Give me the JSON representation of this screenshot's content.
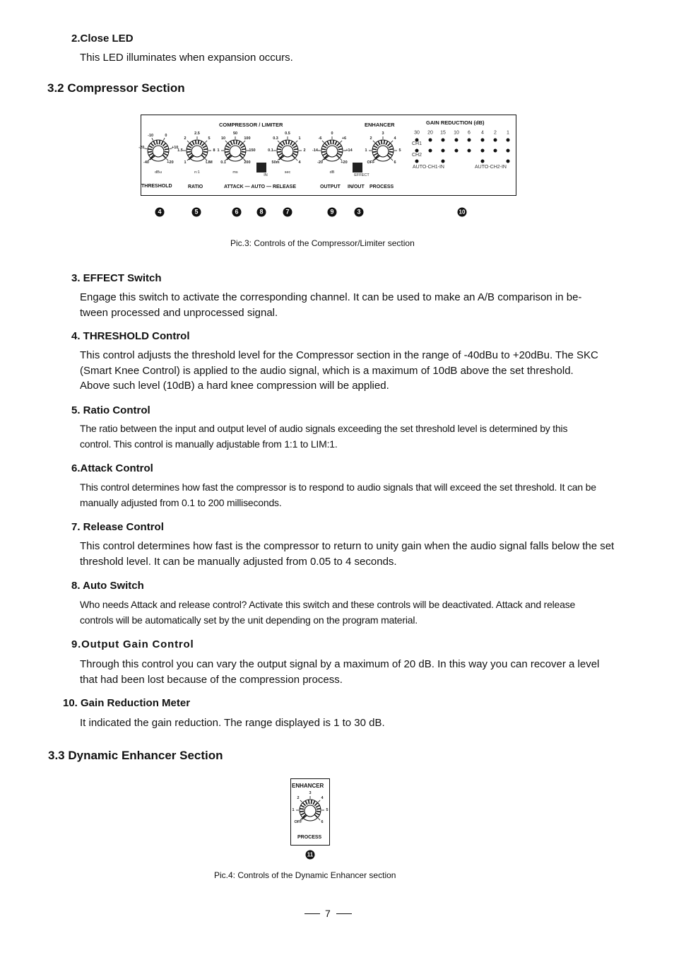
{
  "sections": {
    "close_led": {
      "heading": "2.Close LED",
      "text": "This LED illuminates when expansion occurs."
    },
    "compressor": {
      "heading": "3.2 Compressor Section"
    },
    "enhancer_section": {
      "heading": "3.3 Dynamic Enhancer Section"
    }
  },
  "figure3": {
    "caption": "Pic.3: Controls of the Compressor/Limiter section",
    "panel": {
      "compressor_title": "COMPRESSOR / LIMITER",
      "enhancer_title": "ENHANCER",
      "gain_title": "GAIN REDUCTION (dB)",
      "knobs": [
        {
          "id": "threshold",
          "scale": [
            "-40",
            "-20",
            "-10",
            "0",
            "+10",
            "+20"
          ],
          "unit": "dBu"
        },
        {
          "id": "ratio",
          "scale": [
            "1",
            "1.5",
            "2",
            "2.5",
            "5",
            "8",
            "LIM"
          ],
          "unit": "n:1"
        },
        {
          "id": "attack",
          "scale": [
            "0.1",
            "1",
            "10",
            "50",
            "100",
            "150",
            "200"
          ],
          "unit": "ms"
        },
        {
          "id": "release",
          "scale": [
            "50m",
            "0.1",
            "0.3",
            "0.5",
            "1",
            "2",
            "4"
          ],
          "unit": "sec"
        },
        {
          "id": "output",
          "scale": [
            "-20",
            "-14",
            "-6",
            "0",
            "+6",
            "+14",
            "+20"
          ],
          "unit": "dB"
        },
        {
          "id": "process",
          "scale": [
            "OFF",
            "1",
            "2",
            "3",
            "4",
            "5",
            "6"
          ],
          "unit": ""
        }
      ],
      "auto_switch_label": "IN",
      "effect_switch_label": "EFFECT",
      "bottom_labels": {
        "threshold": "THRESHOLD",
        "ratio": "RATIO",
        "attack_auto_release": "ATTACK — AUTO — RELEASE",
        "output": "OUTPUT",
        "inout": "IN/OUT",
        "process": "PROCESS"
      },
      "meter_scale": [
        "30",
        "20",
        "15",
        "10",
        "6",
        "4",
        "2",
        "1"
      ],
      "meter_ch1": "CH1",
      "meter_ch2": "CH2",
      "auto_ch1": "AUTO-CH1-IN",
      "auto_ch2": "AUTO-CH2-IN"
    },
    "callouts": [
      "4",
      "5",
      "6",
      "8",
      "7",
      "9",
      "3",
      "10"
    ]
  },
  "items": [
    {
      "heading": "3. EFFECT Switch",
      "lines": [
        "Engage this switch to activate the corresponding channel. It can be used to make an A/B comparison in be-",
        "tween processed and unprocessed signal."
      ]
    },
    {
      "heading": "4. THRESHOLD Control",
      "lines": [
        "This control adjusts the threshold level for the Compressor section in the range of -40dBu to +20dBu. The SKC",
        "(Smart Knee Control) is applied to the audio signal, which is a maximum of 10dB above the set threshold.",
        "Above such level (10dB) a hard knee compression will be applied."
      ]
    },
    {
      "heading": "5. Ratio Control",
      "lines": [
        "The ratio between the input and output level of audio signals exceeding the set threshold level is determined by this",
        "control. This control is manually adjustable from 1:1 to LIM:1."
      ]
    },
    {
      "heading": "6.Attack Control",
      "lines": [
        "This control determines how fast the compressor is to respond to audio signals that will exceed the set threshold. It can be",
        "manually adjusted from 0.1 to 200 milliseconds."
      ]
    },
    {
      "heading": "7. Release Control",
      "lines": [
        "This control determines how fast is the compressor to return to unity gain when the audio signal falls below the set",
        "threshold level. It can be manually adjusted from 0.05 to 4 seconds."
      ]
    },
    {
      "heading": "8. Auto Switch",
      "lines": [
        "Who needs Attack and release control? Activate this switch and these controls will be deactivated. Attack and release",
        "controls will be automatically set by the unit depending on the program material."
      ]
    },
    {
      "heading": "9.Output Gain Control",
      "lines": [
        "Through this control you can vary the output signal by a maximum of 20 dB. In this way you can recover a level",
        "that had been lost because of the compression process."
      ]
    },
    {
      "heading": "10. Gain Reduction Meter",
      "lines": [
        "It indicated the gain reduction. The range displayed is 1 to 30 dB."
      ]
    }
  ],
  "figure4": {
    "caption": "Pic.4: Controls of the Dynamic Enhancer section",
    "title": "ENHANCER",
    "label": "PROCESS",
    "scale": [
      "OFF",
      "1",
      "2",
      "3",
      "4",
      "5",
      "6"
    ],
    "callout": "11"
  },
  "footer": {
    "page_number": "7"
  }
}
